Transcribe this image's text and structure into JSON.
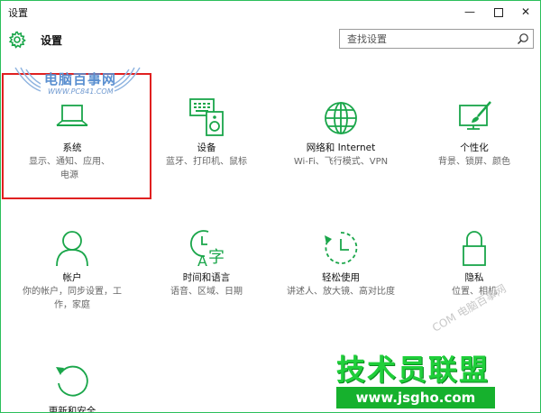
{
  "window": {
    "title": "设置",
    "minimize_glyph": "—",
    "close_glyph": "✕"
  },
  "header": {
    "title": "设置",
    "icon": "gear-icon"
  },
  "search": {
    "placeholder": "查找设置",
    "icon": "search-icon"
  },
  "tiles": [
    {
      "name": "系统",
      "desc": "显示、通知、应用、电源",
      "icon": "laptop-icon"
    },
    {
      "name": "设备",
      "desc": "蓝牙、打印机、鼠标",
      "icon": "devices-icon"
    },
    {
      "name": "网络和 Internet",
      "desc": "Wi-Fi、飞行模式、VPN",
      "icon": "globe-icon"
    },
    {
      "name": "个性化",
      "desc": "背景、锁屏、颜色",
      "icon": "paintbrush-icon"
    },
    {
      "name": "帐户",
      "desc": "你的帐户，同步设置，工作，家庭",
      "icon": "person-icon"
    },
    {
      "name": "时间和语言",
      "desc": "语音、区域、日期",
      "icon": "time-language-icon"
    },
    {
      "name": "轻松使用",
      "desc": "讲述人、放大镜、高对比度",
      "icon": "ease-of-access-icon"
    },
    {
      "name": "隐私",
      "desc": "位置、相机",
      "icon": "lock-icon"
    },
    {
      "name": "更新和安全",
      "desc": "",
      "icon": "update-icon"
    }
  ],
  "watermarks": {
    "logo_top": "电脑百事网",
    "logo_top_url": "WWW.PC841.COM",
    "diagonal": "COM 电脑百事网",
    "brand": "技术员联盟",
    "brand_url": "www.jsgho.com"
  },
  "colors": {
    "accent": "#1aa64a",
    "highlight_box": "#e02020",
    "border": "#2bbf5a"
  }
}
